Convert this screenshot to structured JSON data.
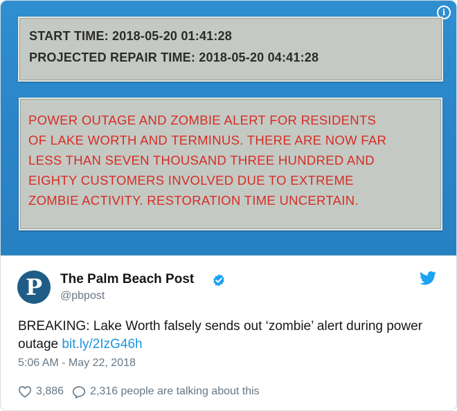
{
  "media": {
    "start_time": "START TIME: 2018-05-20 01:41:28",
    "repair_time": "PROJECTED REPAIR TIME: 2018-05-20 04:41:28",
    "alert_lines": [
      "POWER OUTAGE AND ZOMBIE ALERT FOR RESIDENTS",
      "OF LAKE WORTH AND TERMINUS. THERE ARE NOW FAR",
      "LESS THAN SEVEN THOUSAND THREE HUNDRED AND",
      "EIGHTY CUSTOMERS INVOLVED DUE TO EXTREME",
      "ZOMBIE ACTIVITY. RESTORATION TIME UNCERTAIN."
    ],
    "panel_bg": "#c4c9c3",
    "alert_color": "#d62d26",
    "bg_color": "#2a85c8"
  },
  "info_icon": "info-icon",
  "tweet": {
    "avatar_letter": "P",
    "author_name": "The Palm Beach Post",
    "handle": "@pbpost",
    "text": "BREAKING: Lake Worth falsely sends out ‘zombie’ alert during power outage ",
    "link": "bit.ly/2IzG46h",
    "timestamp": "5:06 AM - May 22, 2018",
    "likes": "3,886",
    "talking": "2,316 people are talking about this",
    "link_color": "#1b95e0",
    "icons": [
      "verified-badge-icon",
      "twitter-bird-icon",
      "heart-icon",
      "speech-bubble-icon"
    ]
  }
}
